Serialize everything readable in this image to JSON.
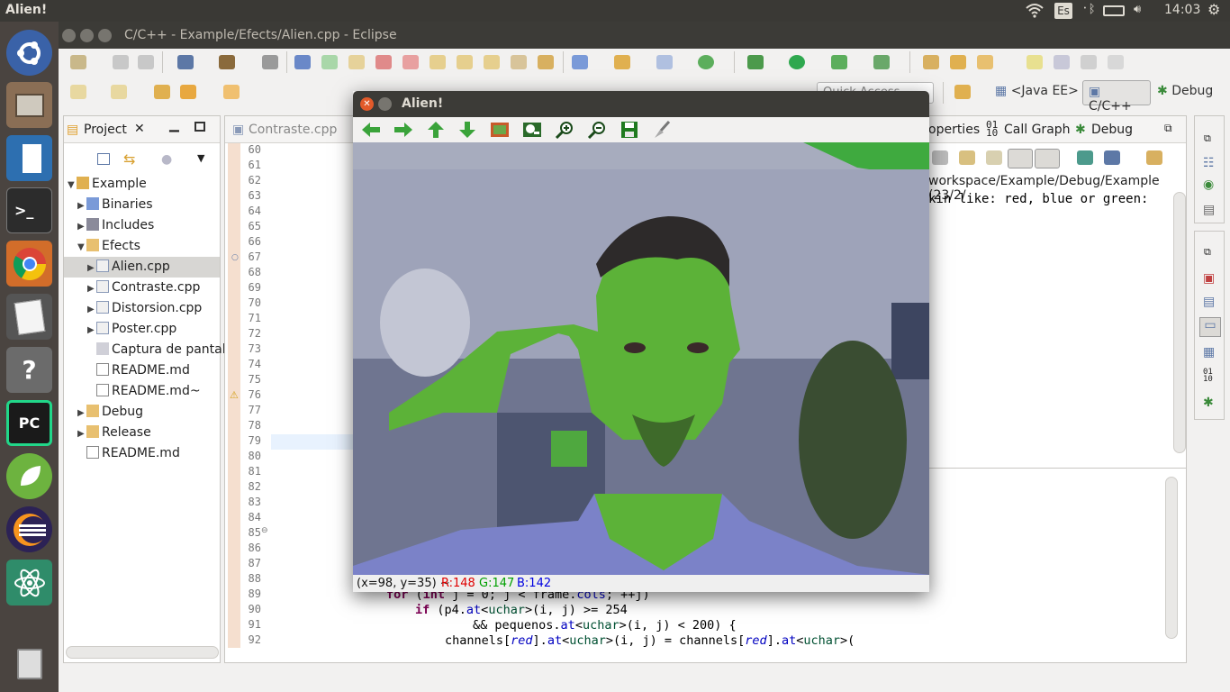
{
  "topbar": {
    "app_title": "Alien!",
    "keyboard": "Es",
    "clock": "14:03"
  },
  "launcher": {
    "icons": [
      "ubuntu-dash-icon",
      "files-icon",
      "libreoffice-writer-icon",
      "terminal-icon",
      "chrome-icon",
      "text-editor-icon",
      "help-icon",
      "pycharm-icon",
      "spring-icon",
      "eclipse-icon",
      "atom-icon",
      "trash-icon"
    ],
    "pycharm_label": "PC"
  },
  "eclipse": {
    "window_title": "C/C++ - Example/Efects/Alien.cpp - Eclipse",
    "quick_access_placeholder": "Quick Access",
    "perspectives": {
      "java_ee": "<Java EE>",
      "cpp": "C/C++",
      "debug": "Debug"
    },
    "project_view": {
      "tab": "Project",
      "tree": [
        {
          "label": "Example",
          "depth": 0,
          "open": true
        },
        {
          "label": "Binaries",
          "depth": 1,
          "open": false
        },
        {
          "label": "Includes",
          "depth": 1,
          "open": false
        },
        {
          "label": "Efects",
          "depth": 1,
          "open": true
        },
        {
          "label": "Alien.cpp",
          "depth": 2,
          "open": false,
          "selected": true
        },
        {
          "label": "Contraste.cpp",
          "depth": 2,
          "open": false
        },
        {
          "label": "Distorsion.cpp",
          "depth": 2,
          "open": false
        },
        {
          "label": "Poster.cpp",
          "depth": 2,
          "open": false
        },
        {
          "label": "Captura de pantall",
          "depth": 2
        },
        {
          "label": "README.md",
          "depth": 2
        },
        {
          "label": "README.md~",
          "depth": 2
        },
        {
          "label": "Debug",
          "depth": 1,
          "open": false
        },
        {
          "label": "Release",
          "depth": 1,
          "open": false
        },
        {
          "label": "README.md",
          "depth": 1
        }
      ]
    },
    "editor": {
      "tab": "Contraste.cpp",
      "line_numbers": [
        "60",
        "61",
        "62",
        "63",
        "64",
        "65",
        "66",
        "67",
        "68",
        "69",
        "70",
        "71",
        "72",
        "73",
        "74",
        "75",
        "76",
        "77",
        "78",
        "79",
        "80",
        "81",
        "82",
        "83",
        "84",
        "85",
        "86",
        "87",
        "88",
        "89",
        "90",
        "91",
        "92"
      ],
      "code_lines": [
        {
          "line": "89",
          "text": "    for (int j = 0; j < frame.cols; ++j)"
        },
        {
          "line": "90",
          "text": "        if (p4.at<uchar>(i, j) >= 254"
        },
        {
          "line": "91",
          "text": "                && pequenos.at<uchar>(i, j) < 200) {"
        },
        {
          "line": "92",
          "text": "            channels[red].at<uchar>(i, j) = channels[red].at<uchar>("
        }
      ]
    },
    "right_tabs": {
      "properties": "operties",
      "call_graph": "Call Graph",
      "debug": "Debug"
    },
    "console": {
      "path": "workspace/Example/Debug/Example (23/2/",
      "output": "kin like: red, blue or green:"
    }
  },
  "alien_window": {
    "title": "Alien!",
    "toolbar": [
      "pan-left-icon",
      "pan-right-icon",
      "pan-up-icon",
      "pan-down-icon",
      "zoom-fit-icon",
      "zoom-region-icon",
      "zoom-in-icon",
      "zoom-out-icon",
      "save-image-icon",
      "properties-icon"
    ],
    "status": {
      "coords": "(x=98, y=35) ~",
      "r": "R:148",
      "g": "G:147",
      "b": "B:142"
    },
    "colors": {
      "r": "#e00000",
      "g": "#00a000",
      "b": "#0000e0"
    }
  }
}
